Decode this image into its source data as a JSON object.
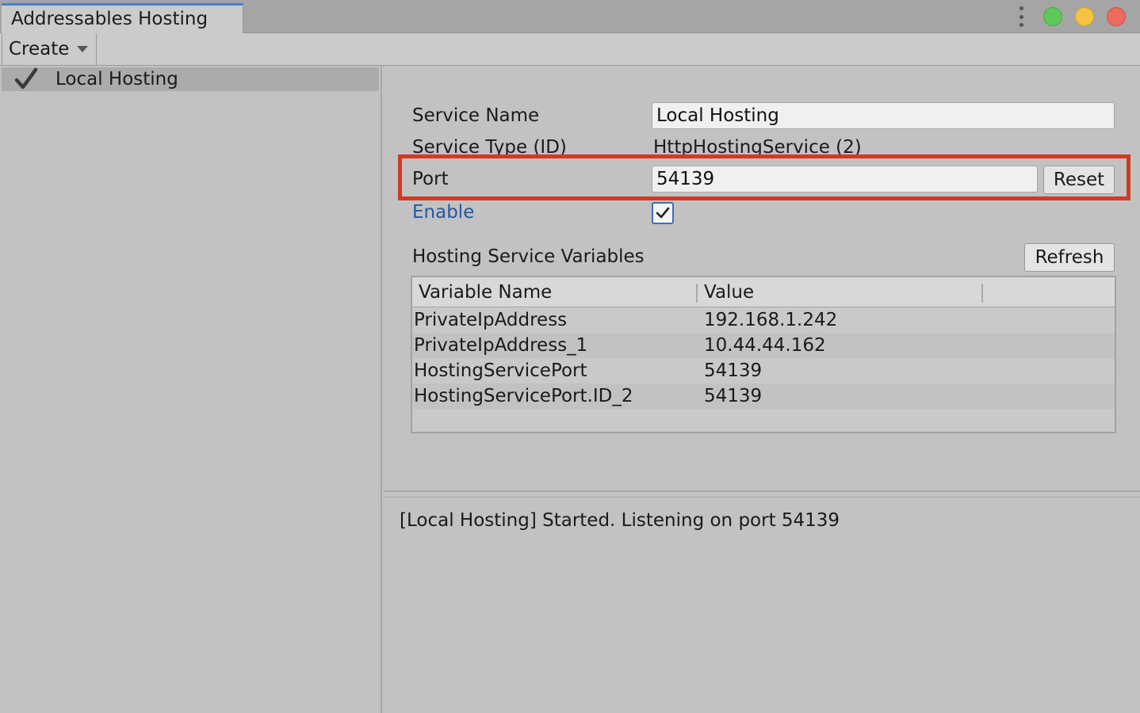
{
  "window": {
    "tab_title": "Addressables Hosting",
    "controls": [
      "more-options",
      "maximize",
      "minimize",
      "close"
    ]
  },
  "toolbar": {
    "create_label": "Create"
  },
  "services_list": {
    "items": [
      {
        "label": "Local Hosting",
        "enabled": true
      }
    ]
  },
  "detail": {
    "service_name_label": "Service Name",
    "service_name_value": "Local Hosting",
    "service_type_label": "Service Type (ID)",
    "service_type_value": "HttpHostingService (2)",
    "port_label": "Port",
    "port_value": "54139",
    "reset_label": "Reset",
    "enable_label": "Enable",
    "enable_checked": true,
    "variables_title": "Hosting Service Variables",
    "refresh_label": "Refresh",
    "table": {
      "headers": [
        "Variable Name",
        "Value"
      ],
      "rows": [
        [
          "PrivateIpAddress",
          "192.168.1.242"
        ],
        [
          "PrivateIpAddress_1",
          "10.44.44.162"
        ],
        [
          "HostingServicePort",
          "54139"
        ],
        [
          "HostingServicePort.ID_2",
          "54139"
        ]
      ]
    }
  },
  "log": {
    "lines": [
      "[Local Hosting] Started. Listening on port 54139"
    ]
  },
  "colors": {
    "highlight": "#d13a22",
    "tab_accent": "#4a7cc7",
    "enable_label": "#2457a3"
  }
}
